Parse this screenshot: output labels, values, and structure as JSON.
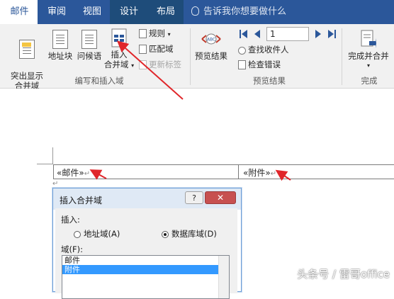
{
  "tabs": [
    {
      "label": "邮件"
    },
    {
      "label": "审阅"
    },
    {
      "label": "视图"
    },
    {
      "label": "设计"
    },
    {
      "label": "布局"
    }
  ],
  "tell_me": "告诉我你想要做什么",
  "ribbon": {
    "highlight_merge_fields": "突出显示\n合并域",
    "address_block": "地址块",
    "greeting_line": "问候语",
    "insert_merge_field_1": "插入",
    "insert_merge_field_2": "合并域",
    "rules": "规则",
    "match_fields": "匹配域",
    "update_labels": "更新标签",
    "group_write_insert": "编写和插入域",
    "preview_results_btn": "预览结果",
    "record_number": "1",
    "find_recipient": "查找收件人",
    "check_errors": "检查错误",
    "group_preview": "预览结果",
    "finish_merge": "完成并合并",
    "group_finish": "完成"
  },
  "document": {
    "cell1": "«邮件»",
    "cell2": "«附件»"
  },
  "dialog": {
    "title": "插入合并域",
    "help": "?",
    "close": "✕",
    "insert_label": "插入:",
    "radio_address": "地址域(A)",
    "radio_database": "数据库域(D)",
    "fields_label": "域(F):",
    "fields": [
      "邮件",
      "附件"
    ]
  },
  "watermark": "头条号 / 雷哥office",
  "colors": {
    "accent": "#2b579a",
    "arrow": "#e0262a"
  }
}
